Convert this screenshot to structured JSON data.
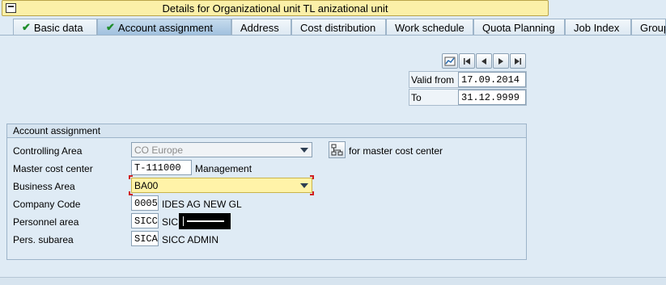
{
  "window": {
    "title": "Details for Organizational unit TL anizational unit"
  },
  "tabs": [
    {
      "label": "Basic data",
      "checked": true
    },
    {
      "label": "Account assignment",
      "checked": true,
      "active": true
    },
    {
      "label": "Address"
    },
    {
      "label": "Cost distribution"
    },
    {
      "label": "Work schedule"
    },
    {
      "label": "Quota Planning"
    },
    {
      "label": "Job Index"
    },
    {
      "label": "Group"
    }
  ],
  "validity": {
    "from_label": "Valid from",
    "from_value": "17.09.2014",
    "to_label": "To",
    "to_value": "31.12.9999"
  },
  "account": {
    "header": "Account assignment",
    "controlling_area_label": "Controlling Area",
    "controlling_area_value": "CO Europe",
    "master_cc_label": "Master cost center",
    "master_cc_value": "T-111000",
    "master_cc_text": "Management",
    "master_cc_link": "for master cost center",
    "business_area_label": "Business Area",
    "business_area_value": "BA00",
    "company_code_label": "Company Code",
    "company_code_value": "0005",
    "company_code_text": "IDES AG NEW GL",
    "personnel_area_label": "Personnel area",
    "personnel_area_value": "SICC",
    "personnel_area_text": "SIC",
    "subarea_label": "Pers. subarea",
    "subarea_value": "SICA",
    "subarea_text": "SICC ADMIN"
  },
  "icons": [
    "window-icon",
    "check-icon",
    "overview-icon",
    "first-page-icon",
    "previous-icon",
    "next-icon",
    "last-page-icon",
    "master-cost-center-icon",
    "dropdown-arrow-icon"
  ],
  "colors": {
    "title_bg": "#fbf0a8",
    "active_tab": "#a7c5e1",
    "required_highlight": "#fff3a8",
    "check_green": "#1e8d2a"
  }
}
